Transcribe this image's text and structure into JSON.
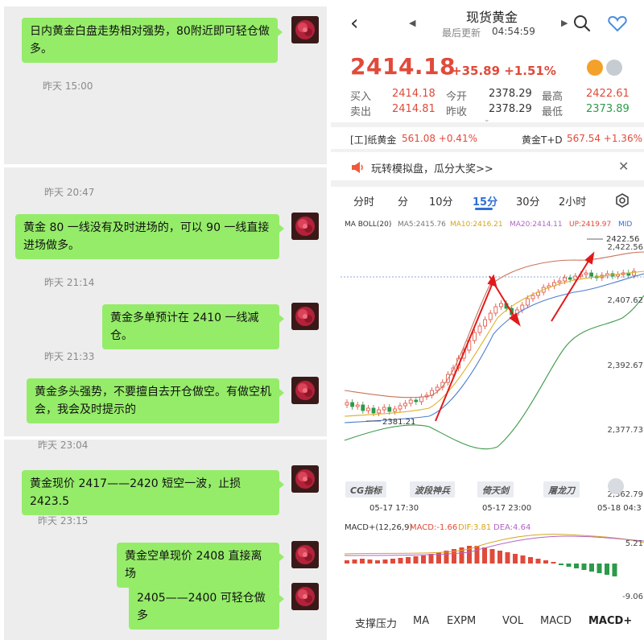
{
  "chat": {
    "messages": [
      {
        "text": "日内黄金白盘走势相对强势，80附近即可轻仓做多。"
      },
      {
        "text": "黄金 80 一线没有及时进场的，可以 90 一线直接进场做多。"
      },
      {
        "text": "黄金多单预计在 2410 一线减仓。"
      },
      {
        "text": "黄金多头强势，不要擅自去开仓做空。有做空机会，我会及时提示的"
      },
      {
        "text": "黄金现价 2417——2420 短空一波，止损 2423.5"
      },
      {
        "text": "黄金空单现价 2408 直接离场"
      },
      {
        "text": "2405——2400 可轻仓做多"
      }
    ],
    "timestamps": [
      "昨天 15:00",
      "昨天 20:47",
      "昨天 21:14",
      "昨天 21:33",
      "昨天 23:04",
      "昨天 23:15"
    ]
  },
  "nav": {
    "back_icon": "chevron-left-icon",
    "title": "现货黄金",
    "sub_label": "最后更新",
    "sub_time": "04:54:59"
  },
  "quote": {
    "price": "2414.18",
    "change": "+35.89 +1.51%",
    "buy_label": "买入",
    "buy": "2414.18",
    "sell_label": "卖出",
    "sell": "2414.81",
    "open_label": "今开",
    "open": "2378.29",
    "prev_label": "昨收",
    "prev": "2378.29",
    "high_label": "最高",
    "high": "2422.61",
    "low_label": "最低",
    "low": "2373.89"
  },
  "related": [
    {
      "name": "[工]纸黄金",
      "value": "561.08 +0.41%"
    },
    {
      "name": "黄金T+D",
      "value": "567.54 +1.36%"
    }
  ],
  "promo": {
    "text": "玩转模拟盘，瓜分大奖>>"
  },
  "tabs": [
    "分时",
    "分",
    "10分",
    "15分",
    "30分",
    "2小时"
  ],
  "indicators": {
    "name": "MA BOLL(20)",
    "ma5": "MA5:2415.76",
    "ma10": "MA10:2416.21",
    "ma20": "MA20:2414.11",
    "up": "UP:2419.97",
    "mid": "MID"
  },
  "chart_labels": {
    "y1": "2,422.56",
    "y2": "2,407.62",
    "y3": "2,392.67",
    "y4": "2,377.73",
    "y5": "2,362.79",
    "high_mark": "2422.56",
    "low_mark": "2381.21"
  },
  "tools": [
    "CG指标",
    "波段神兵",
    "倚天剑",
    "屠龙刀"
  ],
  "time_axis": [
    "05-17 17:30",
    "05-17 23:00",
    "05-18 04:3"
  ],
  "macd": {
    "name": "MACD+(12,26,9)",
    "macd": "MACD:-1.66",
    "dif": "DIF:3.81",
    "dea": "DEA:4.64",
    "top": "5.21",
    "bottom": "-9.06"
  },
  "bottom_tabs": [
    "支撑压力",
    "MA",
    "EXPM",
    "VOL",
    "MACD",
    "MACD+"
  ],
  "colors": {
    "up": "#e04a3a",
    "down": "#2c9a4a",
    "accent": "#2f6fd6",
    "bubble": "#95ec69"
  }
}
